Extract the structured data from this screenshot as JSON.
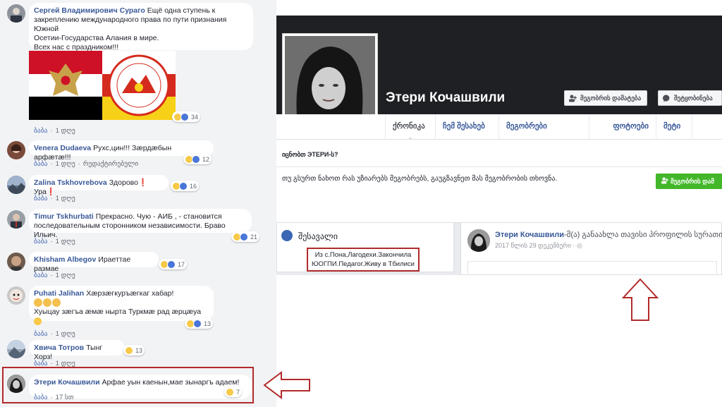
{
  "comments": [
    {
      "author": "Сергей Владимирович Сураго",
      "text_lines": [
        "Ещё одна ступень к",
        "закреплению международного права по пути признания Южной",
        "Осетии-Государства Алания в мире.",
        "Всех нас с праздником!!!"
      ],
      "like": "ბაბა",
      "time": "1 დღე",
      "reactions": "34"
    },
    {
      "author": "Venera Dudaeva",
      "text": "Рухс,цин!!! Зæрдæбын арфæтæ!!!",
      "like": "ბაბა",
      "time": "1 დღე",
      "edited": "რედაქტირებული",
      "reactions": "12"
    },
    {
      "author": "Zalina Tskhovrebova",
      "text": "Здорово❗ Ура❗",
      "like": "ბაბა",
      "time": "1 დღე",
      "reactions": "16"
    },
    {
      "author": "Timur Tskhurbati",
      "text_lines": [
        "Прекрасно. Чую - АИБ , - становится",
        "последовательным сторонником независимости. Браво Ильич."
      ],
      "like": "ბაბა",
      "time": "1 დღე",
      "reactions": "21"
    },
    {
      "author": "Khisham Albegov",
      "text": "Ираеттае размае",
      "like": "ბაბა",
      "time": "1 დღე",
      "reactions": "17"
    },
    {
      "author": "Puhati Jalihan",
      "text_lines": [
        "Хæрзæгкуръæгкаг хабар!",
        "",
        "Хуыцау зæгъа æмæ нырта Туркмæ рад æрцæуа"
      ],
      "like": "ბაბა",
      "time": "1 დღე",
      "reactions": "13"
    },
    {
      "author": "Хвича Тотров",
      "text": "Тынг Хорз!",
      "like": "ბაბა",
      "time": "1 დღე",
      "reactions": "13"
    },
    {
      "author": "Этери Кочашвили",
      "text": "Арфае уын каенын,мае зынаргъ адаем!",
      "like": "ბაბა",
      "time": "17 სთ",
      "reactions": "7"
    }
  ],
  "profile": {
    "name": "Этери Кочашвили",
    "add_friend": "მეგობრის დამატება",
    "message": "შეტყობინება",
    "tabs": [
      "ქრონიკა",
      "ჩემ შესახებ",
      "მეგობრები",
      "ფოტოები",
      "მეტი ▾"
    ],
    "know_question": "იცნობთ ЭТЕРИ-ს?",
    "know_text": "თუ გსურთ ნახოთ რას უზიარებს მეგობრებს, გაუგზავნეთ მას მეგობრობის თხოვნა.",
    "add_friend_green": "მეგობრის დამ",
    "intro_title": "შესავალი",
    "bio_line1": "Из с.Пона,Лагодехи.Закончила",
    "bio_line2": "ЮОГПИ.Педагог.Живу в Тбилиси",
    "post_author": "Этери Кочашвили",
    "post_action": "-მ(ა) განაახლა თავისი პროფილის სურათი.",
    "post_date": "2017 წლის 29 დეკემბერი · ◎"
  },
  "colors": {
    "highlight": "#b22a2a",
    "link": "#385898",
    "green": "#42b72a"
  }
}
